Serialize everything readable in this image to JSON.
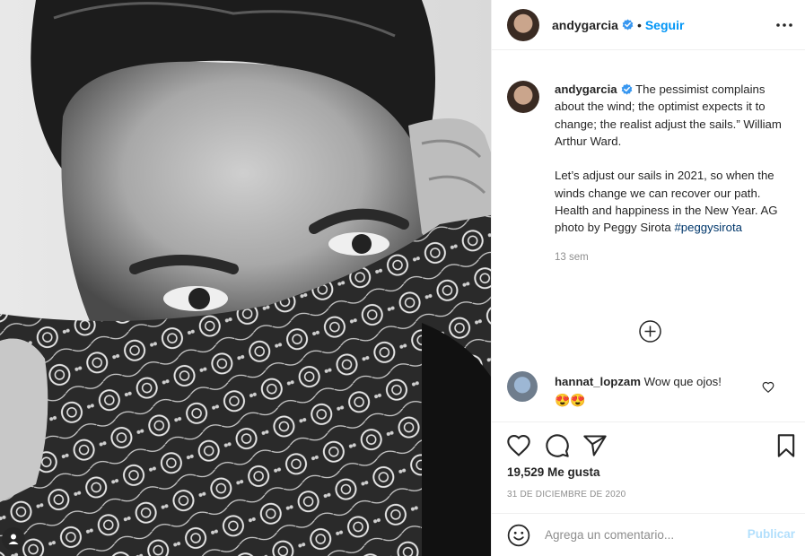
{
  "post": {
    "image_description_icon": "user-tag-icon"
  },
  "header": {
    "username": "andygarcia",
    "separator": "•",
    "follow_label": "Seguir",
    "verified_icon": "verified-badge-icon",
    "more_icon": "more-options-icon"
  },
  "caption": {
    "username": "andygarcia",
    "text": " The pessimist complains about the wind; the optimist expects it to change; the realist adjust the sails.” William Arthur Ward.\n\nLet’s adjust our sails in 2021, so when the winds change we can recover our path. Health and happiness in the New Year. AG photo by Peggy Sirota ",
    "hashtag": "#peggysirota",
    "time": "13 sem"
  },
  "load_more_icon": "plus-circle-icon",
  "comments": [
    {
      "username": "hannat_lopzam",
      "text": " Wow que ojos!",
      "emojis": "😍😍"
    }
  ],
  "actions": {
    "like_icon": "heart-icon",
    "comment_icon": "comment-icon",
    "share_icon": "share-icon",
    "save_icon": "bookmark-icon"
  },
  "likes_text": "19,529 Me gusta",
  "date_text": "31 DE DICIEMBRE DE 2020",
  "add_comment": {
    "emoji_icon": "smiley-icon",
    "placeholder": "Agrega un comentario...",
    "publish_label": "Publicar"
  },
  "colors": {
    "accent": "#0095f6",
    "hashtag": "#00376b",
    "muted": "#8e8e8e",
    "publish_disabled": "#b2dffc",
    "border": "#efefef"
  }
}
